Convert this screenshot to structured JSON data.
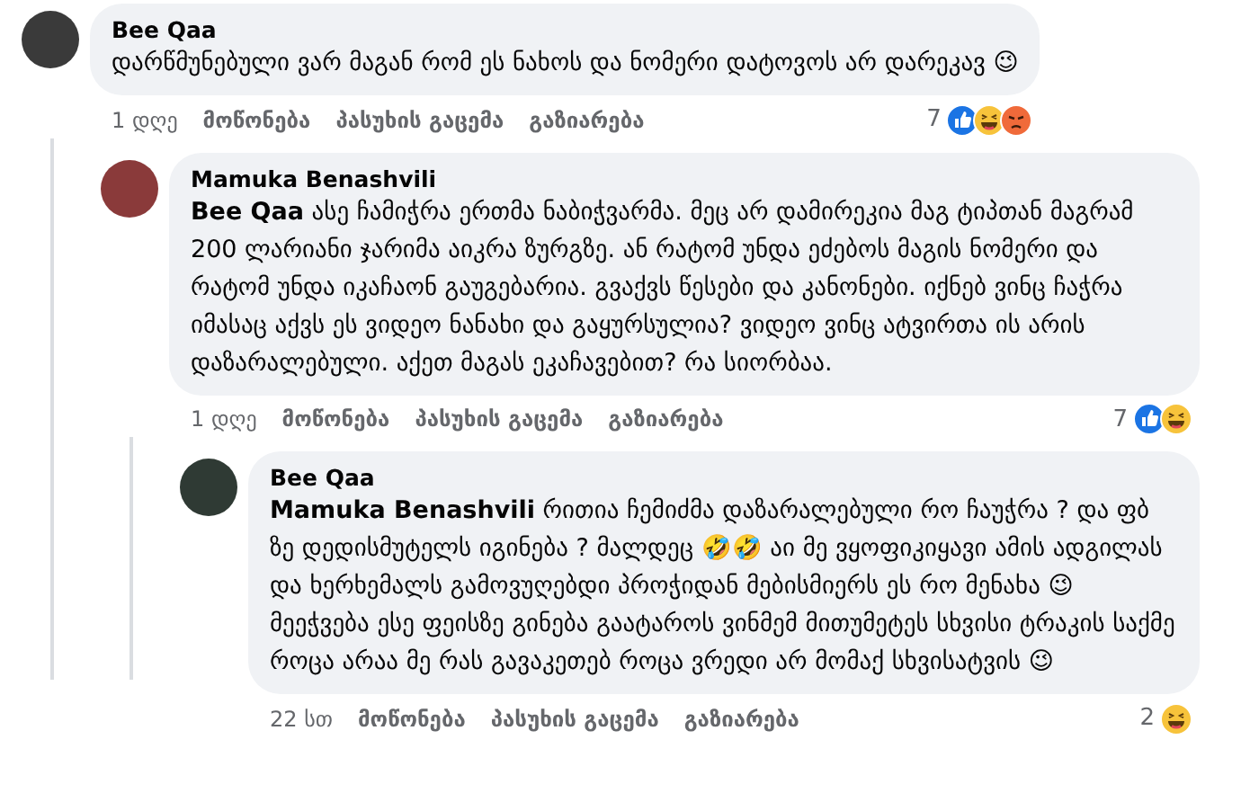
{
  "comments": [
    {
      "author": "Bee Qaa",
      "text": "დარწმუნებული ვარ მაგან რომ ეს ნახოს და ნომერი დატოვოს არ დარეკავ 😉",
      "time": "1 დღე",
      "actions": [
        "მოწონება",
        "პასუხის გაცემა",
        "გაზიარება"
      ],
      "reaction_count": "7",
      "reactions": [
        {
          "kind": "like"
        },
        {
          "kind": "haha"
        },
        {
          "kind": "angry"
        }
      ],
      "replies": [
        {
          "author": "Mamuka Benashvili",
          "text": "**Bee Qaa** ასე ჩამიჭრა ერთმა ნაბიჭვარმა. მეც არ დამირეკია მაგ ტიპთან მაგრამ 200 ლარიანი ჯარიმა აიკრა ზურგზე. ან რატომ უნდა ეძებოს მაგის ნომერი და რატომ უნდა იკაჩაონ გაუგებარია. გვაქვს წესები და კანონები. იქნებ ვინც ჩაჭრა იმასაც აქვს ეს ვიდეო ნანახი და გაყურსულია? ვიდეო ვინც ატვირთა ის არის დაზარალებული. აქეთ მაგას ეკაჩავებით? რა სიორბაა.",
          "time": "1 დღე",
          "actions": [
            "მოწონება",
            "პასუხის გაცემა",
            "გაზიარება"
          ],
          "reaction_count": "7",
          "reactions": [
            {
              "kind": "like"
            },
            {
              "kind": "haha"
            }
          ],
          "replies": [
            {
              "author": "Bee Qaa",
              "text": "**Mamuka Benashvili** რითია ჩემიძმა დაზარალებული რო ჩაუჭრა ? და ფბ ზე დედისმუტელს იგინება ? მალდეც 🤣🤣 აი მე ვყოფიკიყავი ამის ადგილას და ხერხემალს გამოვუღებდი პროჭიდან მებისმიერს ეს რო მენახა 😉 მეეჭვება ესე ფეისზე გინება გაატაროს ვინმემ მითუმეტეს სხვისი ტრაკის საქმე როცა არაა მე რას გავაკეთებ როცა ვრედი არ მომაქ სხვისატვის 😉",
              "time": "22 სთ",
              "actions": [
                "მოწონება",
                "პასუხის გაცემა",
                "გაზიარება"
              ],
              "reaction_count": "2",
              "reactions": [
                {
                  "kind": "haha"
                }
              ]
            }
          ]
        }
      ]
    }
  ]
}
